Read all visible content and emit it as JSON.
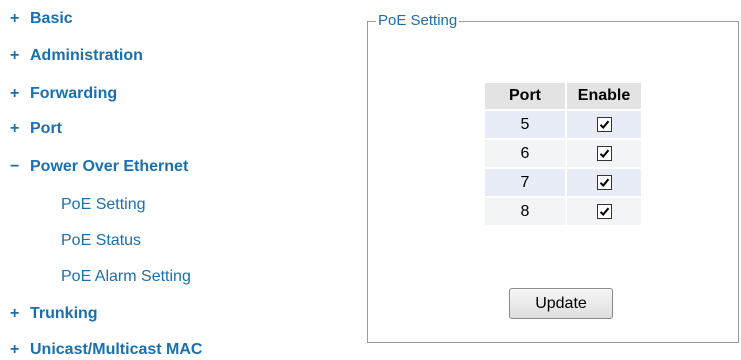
{
  "sidebar": {
    "items": [
      {
        "toggle": "+",
        "label": "Basic"
      },
      {
        "toggle": "+",
        "label": "Administration"
      },
      {
        "toggle": "+",
        "label": "Forwarding"
      },
      {
        "toggle": "+",
        "label": "Port"
      },
      {
        "toggle": "−",
        "label": "Power Over Ethernet"
      },
      {
        "toggle": "+",
        "label": "Trunking"
      },
      {
        "toggle": "+",
        "label": "Unicast/Multicast MAC"
      }
    ],
    "poe_subitems": [
      "PoE Setting",
      "PoE Status",
      "PoE Alarm Setting"
    ]
  },
  "poe_setting": {
    "legend": "PoE Setting",
    "headers": {
      "port": "Port",
      "enable": "Enable"
    },
    "rows": [
      {
        "port": "5",
        "enabled": true
      },
      {
        "port": "6",
        "enabled": true
      },
      {
        "port": "7",
        "enabled": true
      },
      {
        "port": "8",
        "enabled": true
      }
    ],
    "update_label": "Update"
  },
  "colors": {
    "link": "#1a6fb0",
    "header_bg": "#e3e3e3",
    "row_odd_bg": "#e8ecf6",
    "row_even_bg": "#f3f4f8"
  }
}
